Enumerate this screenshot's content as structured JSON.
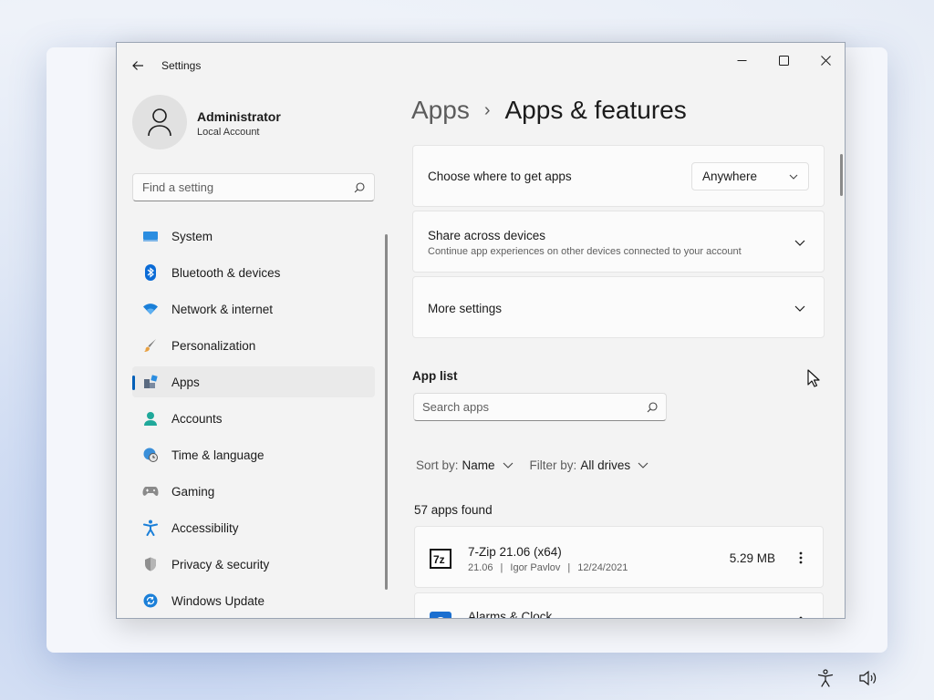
{
  "window": {
    "title": "Settings",
    "controls": [
      "minimize-icon",
      "maximize-icon",
      "close-icon"
    ]
  },
  "profile": {
    "name": "Administrator",
    "account_type": "Local Account",
    "avatar_icon": "person-icon"
  },
  "sidebar": {
    "search_placeholder": "Find a setting",
    "search_icon": "search-icon",
    "items": [
      {
        "label": "System",
        "icon": "system-icon",
        "active": false
      },
      {
        "label": "Bluetooth & devices",
        "icon": "bluetooth-icon",
        "active": false
      },
      {
        "label": "Network & internet",
        "icon": "wifi-icon",
        "active": false
      },
      {
        "label": "Personalization",
        "icon": "brush-icon",
        "active": false
      },
      {
        "label": "Apps",
        "icon": "apps-icon",
        "active": true
      },
      {
        "label": "Accounts",
        "icon": "accounts-icon",
        "active": false
      },
      {
        "label": "Time & language",
        "icon": "globe-clock-icon",
        "active": false
      },
      {
        "label": "Gaming",
        "icon": "gamepad-icon",
        "active": false
      },
      {
        "label": "Accessibility",
        "icon": "accessibility-icon",
        "active": false
      },
      {
        "label": "Privacy & security",
        "icon": "shield-icon",
        "active": false
      },
      {
        "label": "Windows Update",
        "icon": "update-icon",
        "active": false
      }
    ]
  },
  "breadcrumb": {
    "parent": "Apps",
    "separator": "›",
    "current": "Apps & features"
  },
  "settings_cards": {
    "get_apps": {
      "label": "Choose where to get apps",
      "value": "Anywhere"
    },
    "share": {
      "label": "Share across devices",
      "description": "Continue app experiences on other devices connected to your account"
    },
    "more": {
      "label": "More settings"
    }
  },
  "app_list": {
    "heading": "App list",
    "search_placeholder": "Search apps",
    "sort_label": "Sort by:",
    "sort_value": "Name",
    "filter_label": "Filter by:",
    "filter_value": "All drives",
    "count_text": "57 apps found",
    "apps": [
      {
        "name": "7-Zip 21.06 (x64)",
        "version": "21.06",
        "publisher": "Igor Pavlov",
        "date": "12/24/2021",
        "size": "5.29 MB",
        "icon": "7zip-icon"
      },
      {
        "name": "Alarms & Clock",
        "version": "",
        "publisher": "",
        "date": "",
        "size": "",
        "icon": "alarm-clock-icon"
      }
    ]
  },
  "taskbar": {
    "tray_icons": [
      "accessibility-icon",
      "volume-icon"
    ]
  },
  "colors": {
    "accent": "#005fb8",
    "window_bg": "#f3f3f3",
    "card_bg": "#fbfbfb"
  }
}
